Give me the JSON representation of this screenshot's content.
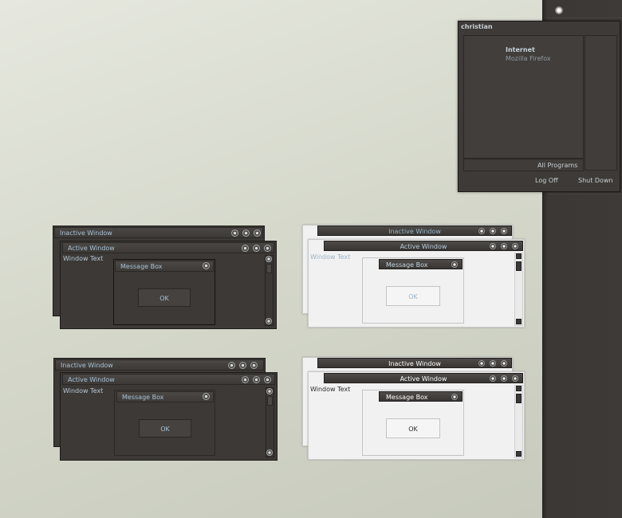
{
  "taskbar": {
    "user_name": "christian"
  },
  "start_menu": {
    "pinned_title": "Internet",
    "pinned_subtitle": "Mozilla Firefox",
    "all_programs": "All Programs",
    "log_off": "Log Off",
    "shut_down": "Shut Down"
  },
  "previews": {
    "inactive_title": "Inactive Window",
    "active_title": "Active Window",
    "window_text": "Window Text",
    "message_box_title": "Message Box",
    "ok_label": "OK"
  },
  "colors": {
    "dark_frame": "#3c3936",
    "dark_title_text": "#a9c2d6",
    "light_body": "#f1f1f1",
    "light_disabled_text": "#9ab4c8",
    "desktop": "#d5d8cb"
  }
}
